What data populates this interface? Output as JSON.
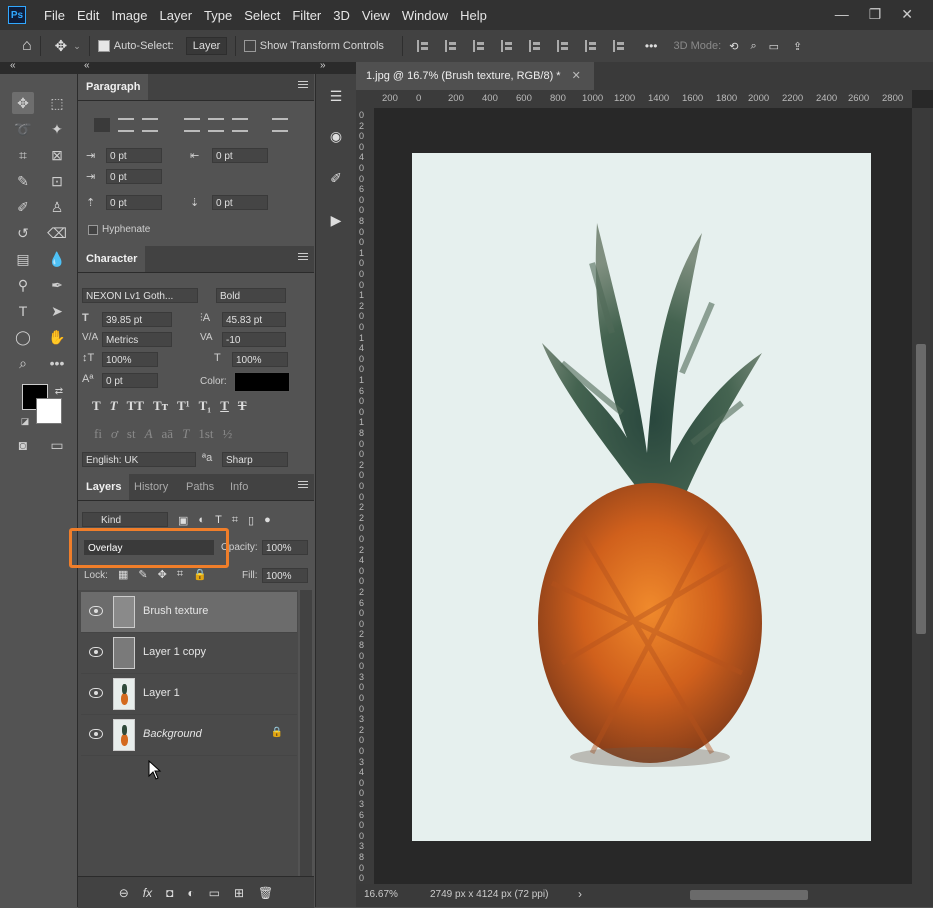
{
  "app": {
    "logo": "Ps"
  },
  "menu": [
    "File",
    "Edit",
    "Image",
    "Layer",
    "Type",
    "Select",
    "Filter",
    "3D",
    "View",
    "Window",
    "Help"
  ],
  "window_controls": [
    "—",
    "❐",
    "✕"
  ],
  "options_bar": {
    "auto_select_label": "Auto-Select:",
    "auto_select_value": "Layer",
    "show_transform_label": "Show Transform Controls",
    "mode_3d_label": "3D Mode:",
    "more_label": "•••"
  },
  "collapse_arrows": [
    "«",
    "«",
    "»"
  ],
  "paragraph_panel": {
    "title": "Paragraph",
    "indent_left": "0 pt",
    "indent_right": "0 pt",
    "indent_first": "0 pt",
    "space_before": "0 pt",
    "space_after": "0 pt",
    "hyphenate_label": "Hyphenate"
  },
  "character_panel": {
    "title": "Character",
    "font_family": "NEXON Lv1 Goth...",
    "font_style": "Bold",
    "font_size": "39.85 pt",
    "leading": "45.83 pt",
    "kerning": "Metrics",
    "tracking": "-10",
    "vertical_scale": "100%",
    "horizontal_scale": "100%",
    "baseline_shift": "0 pt",
    "color_label": "Color:",
    "language": "English: UK",
    "aa_glyph": "ªa",
    "antialias": "Sharp",
    "type_style_glyphs": [
      "T",
      "T",
      "TT",
      "Tт",
      "T¹",
      "T₁",
      "T",
      "T"
    ],
    "opentype_glyphs": [
      "fi",
      "ơ",
      "st",
      "A",
      "aā",
      "T",
      "1st",
      "½"
    ]
  },
  "layers_panel": {
    "tabs": [
      "Layers",
      "History",
      "Paths",
      "Info"
    ],
    "filter_label": "Kind",
    "blend_mode": "Overlay",
    "opacity_label": "Opacity:",
    "opacity_value": "100%",
    "lock_label": "Lock:",
    "fill_label": "Fill:",
    "fill_value": "100%",
    "layers": [
      {
        "name": "Brush texture",
        "selected": true
      },
      {
        "name": "Layer 1 copy",
        "selected": false
      },
      {
        "name": "Layer 1",
        "selected": false
      },
      {
        "name": "Background",
        "selected": false,
        "locked": true
      }
    ],
    "footer_icons": [
      "link-icon",
      "fx-icon",
      "mask-icon",
      "adjustment-icon",
      "group-icon",
      "new-layer-icon",
      "trash-icon"
    ],
    "footer_glyphs": [
      "⊖",
      "fx",
      "◘",
      "◐",
      "▭",
      "⊞",
      "🗑"
    ]
  },
  "document": {
    "tab_title": "1.jpg @ 16.7% (Brush texture, RGB/8) *",
    "ruler_h_ticks": [
      "200",
      "0",
      "200",
      "400",
      "600",
      "800",
      "1000",
      "1200",
      "1400",
      "1600",
      "1800",
      "2000",
      "2200",
      "2400",
      "2600",
      "2800"
    ],
    "ruler_v_ticks": [
      "0",
      "2",
      "0",
      "0",
      "4",
      "0",
      "0",
      "6",
      "0",
      "0",
      "8",
      "0",
      "0",
      "1",
      "0",
      "0",
      "0",
      "1",
      "2",
      "0",
      "0",
      "1",
      "4",
      "0",
      "0",
      "1",
      "6",
      "0",
      "0",
      "1",
      "8",
      "0",
      "0",
      "2",
      "0",
      "0",
      "0",
      "2",
      "2",
      "0",
      "0",
      "2",
      "4",
      "0",
      "0",
      "2",
      "6",
      "0",
      "0",
      "2",
      "8",
      "0",
      "0",
      "3",
      "0",
      "0",
      "0",
      "3",
      "2",
      "0",
      "0",
      "3",
      "4",
      "0",
      "0",
      "3",
      "6",
      "0",
      "0",
      "3",
      "8",
      "0",
      "0",
      "4",
      "0"
    ],
    "zoom": "16.67%",
    "dimensions": "2749 px x 4124 px (72 ppi)"
  },
  "colors": {
    "accent_highlight": "#f07e2a",
    "foreground": "#000000",
    "background": "#ffffff",
    "canvas_bg": "#e6f0ee"
  }
}
